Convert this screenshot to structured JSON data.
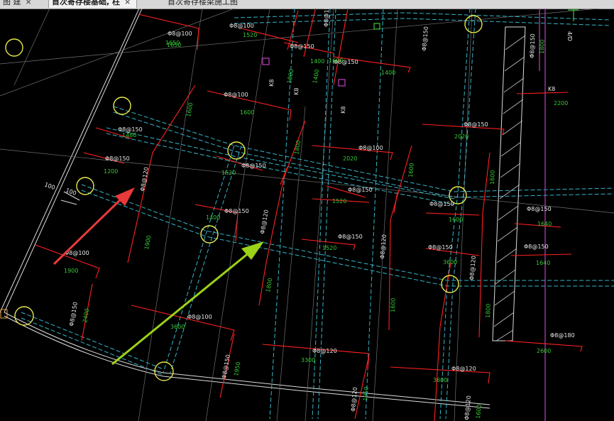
{
  "tabs": [
    {
      "label": "图 建",
      "close": "×"
    },
    {
      "label": "首次寄存楼基础, 柱",
      "close": "×"
    },
    {
      "label": "首次寄存楼梁施工图",
      "close": ""
    }
  ],
  "colors": {
    "background": "#000000",
    "axis_circle": "#e6e64a",
    "rebar_red": "#ff2020",
    "dim_green": "#37c837",
    "dash_cyan": "#36b6c8",
    "annotation_white": "#e8e8e8",
    "arrow_red": "#e83a3a",
    "arrow_green": "#9cd218",
    "magenta": "#c040c0"
  },
  "drawing": {
    "spacing_labels": [
      "Φ8@100",
      "Φ8@100",
      "Φ8@150",
      "Φ8@150",
      "Φ8@100",
      "Φ8@150",
      "Φ8@150",
      "Φ8@100",
      "Φ8@150",
      "Φ8@150",
      "Φ8@150",
      "Φ8@150",
      "Φ8@150",
      "Φ8@120",
      "Φ8@150",
      "Φ8@120",
      "Φ8@150",
      "Φ8@150",
      "Φ8@150",
      "Φ8@120",
      "Φ8@120",
      "Φ8@100",
      "Φ8@100",
      "Φ8@120",
      "Φ8@150",
      "Φ8@120",
      "Φ8@150",
      "Φ8@120",
      "Φ8@180",
      "Φ8@150"
    ],
    "lengths": [
      "1520",
      "1650",
      "1400",
      "1800",
      "1600",
      "1400",
      "2200",
      "1600",
      "1480",
      "1200",
      "1520",
      "1600",
      "1400",
      "1640",
      "1520",
      "1600",
      "1900",
      "1800",
      "1800",
      "1600",
      "1600",
      "2400",
      "3600",
      "3300",
      "1950",
      "1950",
      "3600",
      "1600",
      "1640",
      "2600",
      "1900",
      "1600",
      "2020",
      "1800"
    ],
    "tags": [
      "K8",
      "K8",
      "K8",
      "K8",
      "K8"
    ],
    "dims": [
      "100",
      "100"
    ],
    "side_text": "4/D"
  }
}
